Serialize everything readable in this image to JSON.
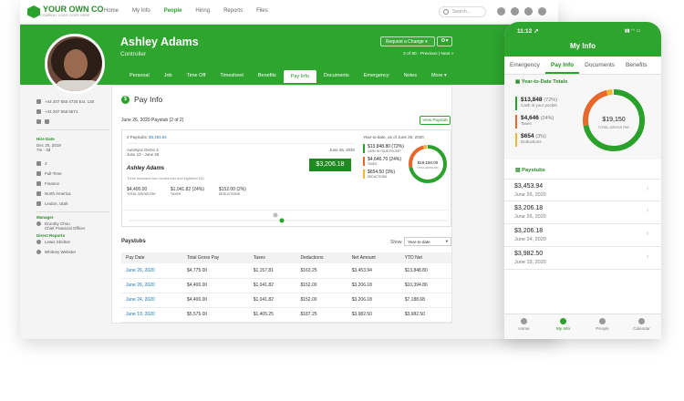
{
  "logo": {
    "name": "YOUR OWN CO",
    "tagline": "COMPANY LOGO GOES HERE"
  },
  "nav": [
    "Home",
    "My Info",
    "People",
    "Hiring",
    "Reports",
    "Files"
  ],
  "search_placeholder": "Search...",
  "employee": {
    "name": "Ashley Adams",
    "title": "Controller"
  },
  "request_change": "Request a Change ▾",
  "pager": "3 of 90 - Previous | Next »",
  "tabs": [
    "Personal",
    "Job",
    "Time Off",
    "Timesheet",
    "Benefits",
    "Pay Info",
    "Documents",
    "Emergency",
    "Notes",
    "More ▾"
  ],
  "left": {
    "phone1": "+44 207 555 4730  Ext. 130",
    "phone2": "+44 207 555 6671",
    "hire_label": "Hire Date",
    "hire_date": "Dec 20, 2019",
    "hire_dur": "7m - 3d",
    "emp_no": "2",
    "status": "Full-Time",
    "dept": "Finance",
    "region": "North America",
    "location": "Lindon, Utah",
    "manager_label": "Manager",
    "manager_name": "Dorothy Chou",
    "manager_title": "Chief Financial Officer",
    "reports_label": "Direct Reports",
    "report1": "Lewis Shelton",
    "report2": "Whitney Webster"
  },
  "payinfo": {
    "title": "Pay Info",
    "stub_header": "June 26, 2020 Paystub (2 of 2)",
    "view_btn": "View Paystub",
    "paystubs_count": "2 Paystubs:",
    "paystubs_amt": "$3,453.94",
    "memo": "Autosync Demo 4",
    "period": "June 13 - June 26",
    "date": "June 26, 2020",
    "payee": "Ashley Adams",
    "words": "Three thousand two hundred six and eighteen/100",
    "amount": "$3,206.18",
    "gross": "$4,400.00",
    "gross_lbl": "TOTAL GROSS PAY",
    "taxes": "$1,041.82",
    "taxes_pct": "(24%)",
    "taxes_lbl": "TAXES",
    "deductions": "$152.00",
    "deductions_pct": "(2%)",
    "deductions_lbl": "DEDUCTIONS",
    "ytd_title": "Year-to-date, as of June 26, 2020",
    "ytd_cash": "$13,848.80",
    "ytd_cash_pct": "(72%)",
    "ytd_cash_lbl": "CASH IN YOUR POCKET",
    "ytd_tax": "$4,646.70",
    "ytd_tax_pct": "(24%)",
    "ytd_tax_lbl": "TAXES",
    "ytd_ded": "$654.50",
    "ytd_ded_pct": "(3%)",
    "ytd_ded_lbl": "DEDUCTIONS",
    "ytd_total": "$19,150.00",
    "ytd_total_lbl": "TOTAL GROSS PAY",
    "paystubs_label": "Paystubs",
    "show_label": "Show",
    "show_value": "Year-to-date"
  },
  "table": {
    "headers": [
      "Pay Date",
      "Total Gross Pay",
      "Taxes",
      "Deductions",
      "Net Amount",
      "YTD Net"
    ],
    "rows": [
      [
        "June 26, 2020",
        "$4,775.00",
        "$1,157.81",
        "$163.25",
        "$3,453.94",
        "$13,848.80"
      ],
      [
        "June 26, 2020",
        "$4,400.00",
        "$1,041.82",
        "$152.00",
        "$3,206.18",
        "$10,394.86"
      ],
      [
        "June 24, 2020",
        "$4,400.00",
        "$1,041.82",
        "$152.00",
        "$3,206.18",
        "$7,188.68"
      ],
      [
        "June 19, 2020",
        "$5,575.00",
        "$1,405.25",
        "$187.25",
        "$3,982.50",
        "$3,982.50"
      ]
    ]
  },
  "phone": {
    "time": "11:12 ↗",
    "title": "My Info",
    "tabs": [
      "Emergency",
      "Pay Info",
      "Documents",
      "Benefits"
    ],
    "ytd_title": "Year-to-Date Totals",
    "cash": "$13,848",
    "cash_pct": "(72%)",
    "cash_lbl": "Cash in your pocket",
    "taxes": "$4,646",
    "taxes_pct": "(24%)",
    "taxes_lbl": "Taxes",
    "ded": "$654",
    "ded_pct": "(3%)",
    "ded_lbl": "Deductions",
    "total": "$19,150",
    "total_lbl": "TOTAL GROSS PAY",
    "stubs_title": "Paystubs",
    "stubs": [
      {
        "amt": "$3,453.94",
        "date": "June 26, 2020"
      },
      {
        "amt": "$3,206.18",
        "date": "June 26, 2020"
      },
      {
        "amt": "$3,206.18",
        "date": "June 24, 2020"
      },
      {
        "amt": "$3,982.50",
        "date": "June 19, 2020"
      }
    ],
    "nav": [
      "Home",
      "My Info",
      "People",
      "Calendar"
    ]
  },
  "colors": {
    "brand": "#2ea52e",
    "cash": "#2aa12a",
    "taxes": "#e8672a",
    "deductions": "#f2b433"
  },
  "ytd_shares": {
    "cash": 0.72,
    "taxes": 0.24,
    "deductions": 0.03
  }
}
